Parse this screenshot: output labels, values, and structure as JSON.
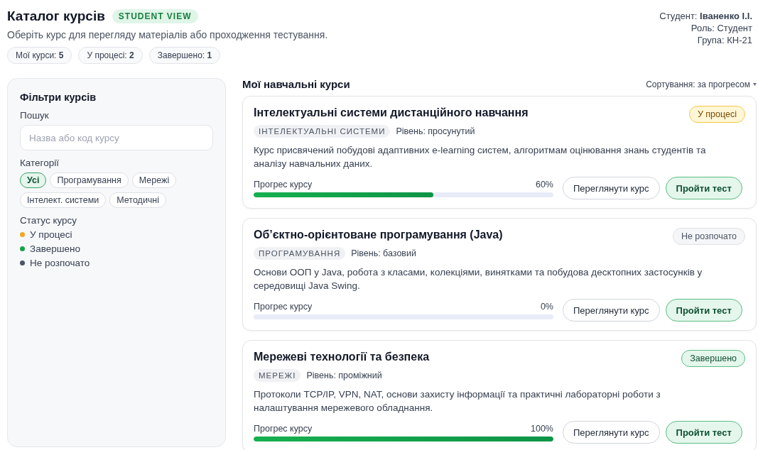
{
  "header": {
    "title": "Каталог курсів",
    "badge": "STUDENT VIEW",
    "subtitle": "Оберіть курс для перегляду матеріалів або проходження тестування.",
    "stats": [
      "Мої курси: **5**",
      "У процесі: **2**",
      "Завершено: **1**"
    ],
    "user": [
      "Студент: **Іваненко І.І.**",
      "Роль: Студент",
      "Група: КН-21"
    ]
  },
  "filters": {
    "title": "Фільтри курсів",
    "search_label": "Пошук",
    "search": {
      "placeholder": "Назва або код курсу"
    },
    "categories_label": "Категорії",
    "categories": [
      {
        "label": "Усі",
        "selected": true
      },
      {
        "label": "Програмування",
        "selected": false
      },
      {
        "label": "Мережі",
        "selected": false
      },
      {
        "label": "Інтелект. системи",
        "selected": false
      },
      {
        "label": "Методичні",
        "selected": false
      }
    ],
    "status_label": "Статус курсу",
    "statuses": [
      {
        "label": "У процесі",
        "color": "#f5a623"
      },
      {
        "label": "Завершено",
        "color": "#16a34a"
      },
      {
        "label": "Не розпочато",
        "color": "#4b5563"
      }
    ]
  },
  "courses_section": {
    "title": "Мої навчальні курси",
    "sort": "Сортування: за прогресом",
    "courses": [
      {
        "title": "Інтелектуальні системи дистанційного навчання",
        "status": {
          "label": "У процесі",
          "kind": "in_progress"
        },
        "category": "ІНТЕЛЕКТУАЛЬНІ СИСТЕМИ",
        "level_label": "Рівень: просунутий",
        "description": "Курс присвячений побудові адаптивних e-learning систем, алгоритмам оцінювання знань студентів та аналізу навчальних даних.",
        "progress_label": "Прогрес курсу",
        "percent": "60%",
        "level": 0.6,
        "buttons": [
          "Переглянути курс",
          "Пройти тест"
        ]
      },
      {
        "title": "Об’єктно-орієнтоване програмування (Java)",
        "status": {
          "label": "Не розпочато",
          "kind": "not_started"
        },
        "category": "ПРОГРАМУВАННЯ",
        "level_label": "Рівень: базовий",
        "description": "Основи ООП у Java, робота з класами, колекціями, винятками та побудова десктопних застосунків у середовищі Java Swing.",
        "progress_label": "Прогрес курсу",
        "percent": "0%",
        "level": 0,
        "buttons": [
          "Переглянути курс",
          "Пройти тест"
        ]
      },
      {
        "title": "Мережеві технології та безпека",
        "status": {
          "label": "Завершено",
          "kind": "done"
        },
        "category": "МЕРЕЖІ",
        "level_label": "Рівень: проміжний",
        "description": "Протоколи TCP/IP, VPN, NAT, основи захисту інформації та практичні лабораторні роботи з налаштування мережевого обладнання.",
        "progress_label": "Прогрес курсу",
        "percent": "100%",
        "level": 1,
        "buttons": [
          "Переглянути курс",
          "Пройти тест"
        ]
      }
    ]
  }
}
